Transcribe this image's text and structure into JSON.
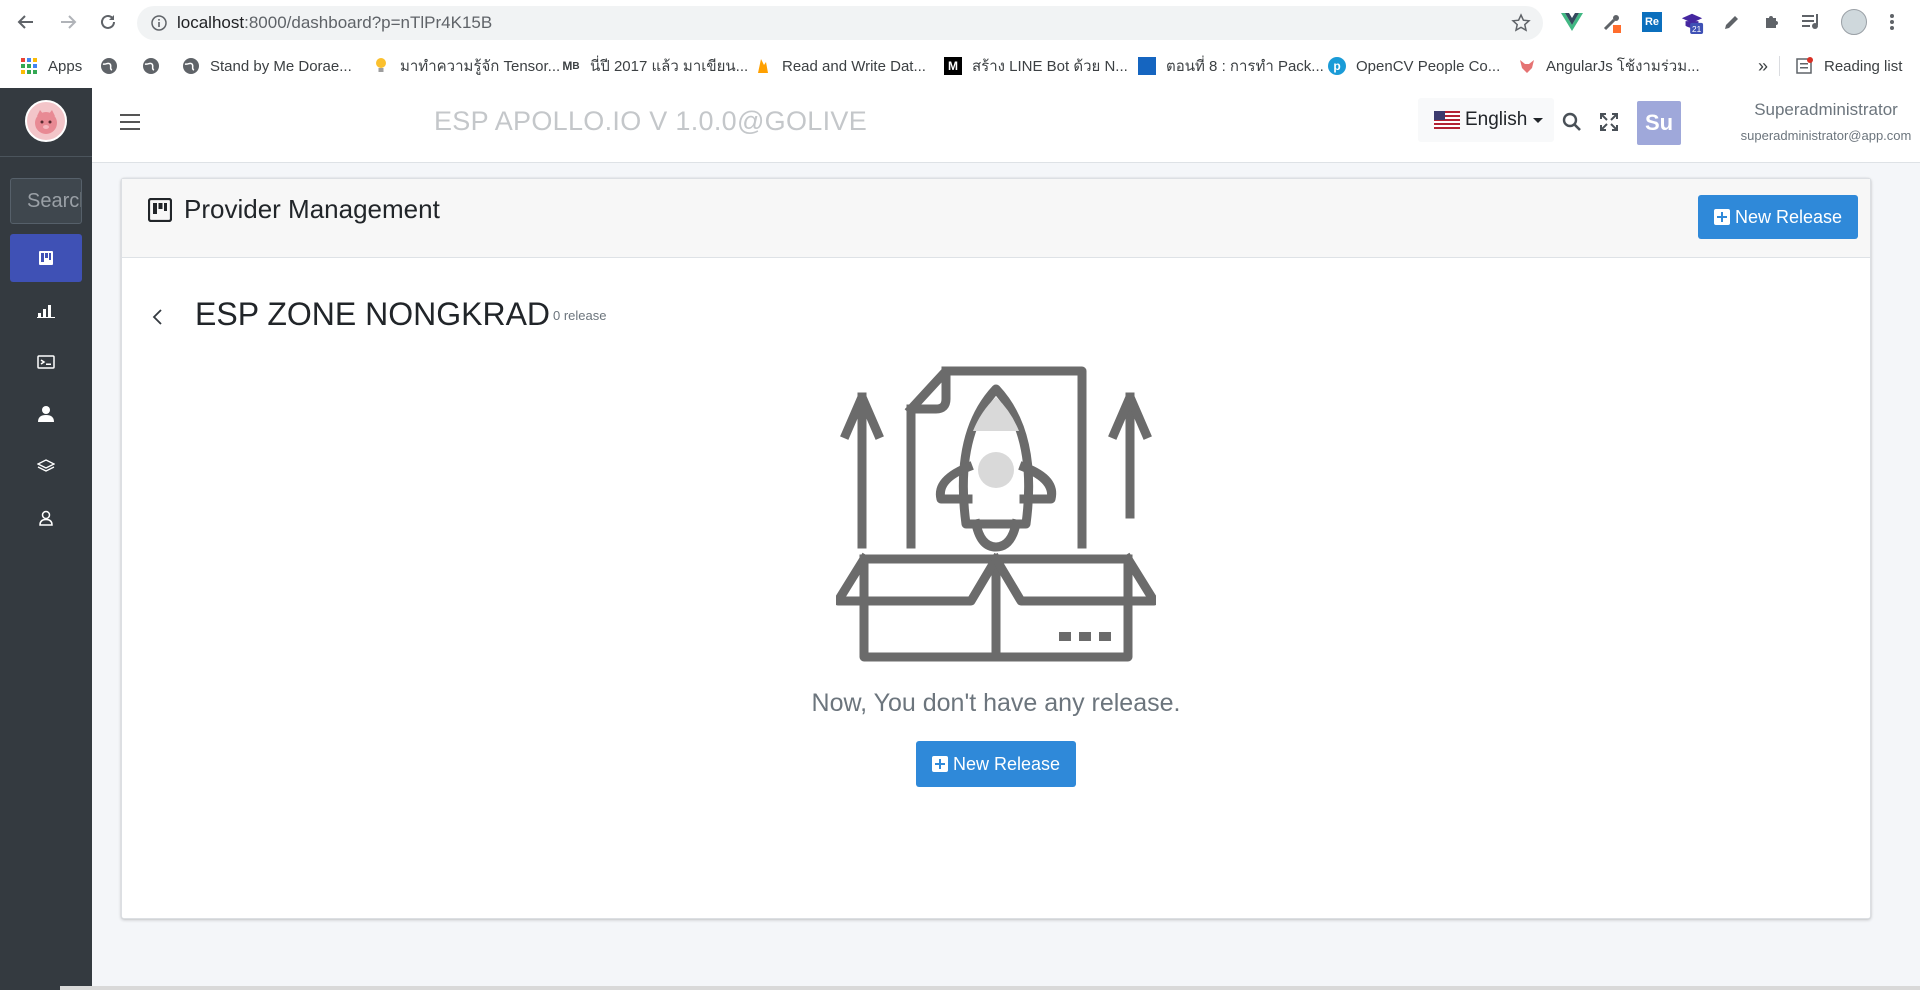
{
  "browser": {
    "url_host": "localhost",
    "url_path": ":8000/dashboard?p=nTlPr4K15B",
    "bookmarks": [
      {
        "icon": "apps-grid-icon",
        "label": "Apps"
      },
      {
        "icon": "globe-icon",
        "label": ""
      },
      {
        "icon": "globe-icon",
        "label": ""
      },
      {
        "icon": "globe-icon",
        "label": "Stand by Me Dorae..."
      },
      {
        "icon": "lightbulb-icon",
        "label": "มาทำความรู้จัก Tensor..."
      },
      {
        "icon": "mb-icon",
        "label": "นี่ปี 2017 แล้ว มาเขียน..."
      },
      {
        "icon": "fire-icon",
        "label": "Read and Write Dat..."
      },
      {
        "icon": "medium-icon",
        "label": "สร้าง LINE Bot ด้วย N..."
      },
      {
        "icon": "blog-icon",
        "label": "ตอนที่ 8 : การทำ Pack..."
      },
      {
        "icon": "pyimagesearch-icon",
        "label": "OpenCV People Co..."
      },
      {
        "icon": "fox-icon",
        "label": "AngularJs โช้งามร่วม..."
      }
    ],
    "more": "»",
    "reading_list": "Reading list",
    "ext_badge": "21"
  },
  "sidebar": {
    "search_placeholder": "Search",
    "items": [
      {
        "icon": "kanban-icon",
        "active": true
      },
      {
        "icon": "bar-chart-icon",
        "active": false
      },
      {
        "icon": "terminal-icon",
        "active": false
      },
      {
        "icon": "user-icon",
        "active": false
      },
      {
        "icon": "layers-icon",
        "active": false
      },
      {
        "icon": "user-outline-icon",
        "active": false
      }
    ]
  },
  "topbar": {
    "brand": "ESP APOLLO.IO V 1.0.0@GOLIVE",
    "language": "English",
    "avatar_initials": "Su",
    "user_name": "Superadministrator",
    "user_email": "superadministrator@app.com"
  },
  "card": {
    "title": "Provider Management",
    "header_button": "New Release",
    "zone_title": "ESP ZONE NONGKRAD",
    "release_count": "0 release",
    "empty_message": "Now, You don't have any release.",
    "empty_button": "New Release"
  },
  "colors": {
    "primary": "#2f89d9",
    "sidebar_bg": "#343a40",
    "sidebar_active": "#3f51b5"
  }
}
